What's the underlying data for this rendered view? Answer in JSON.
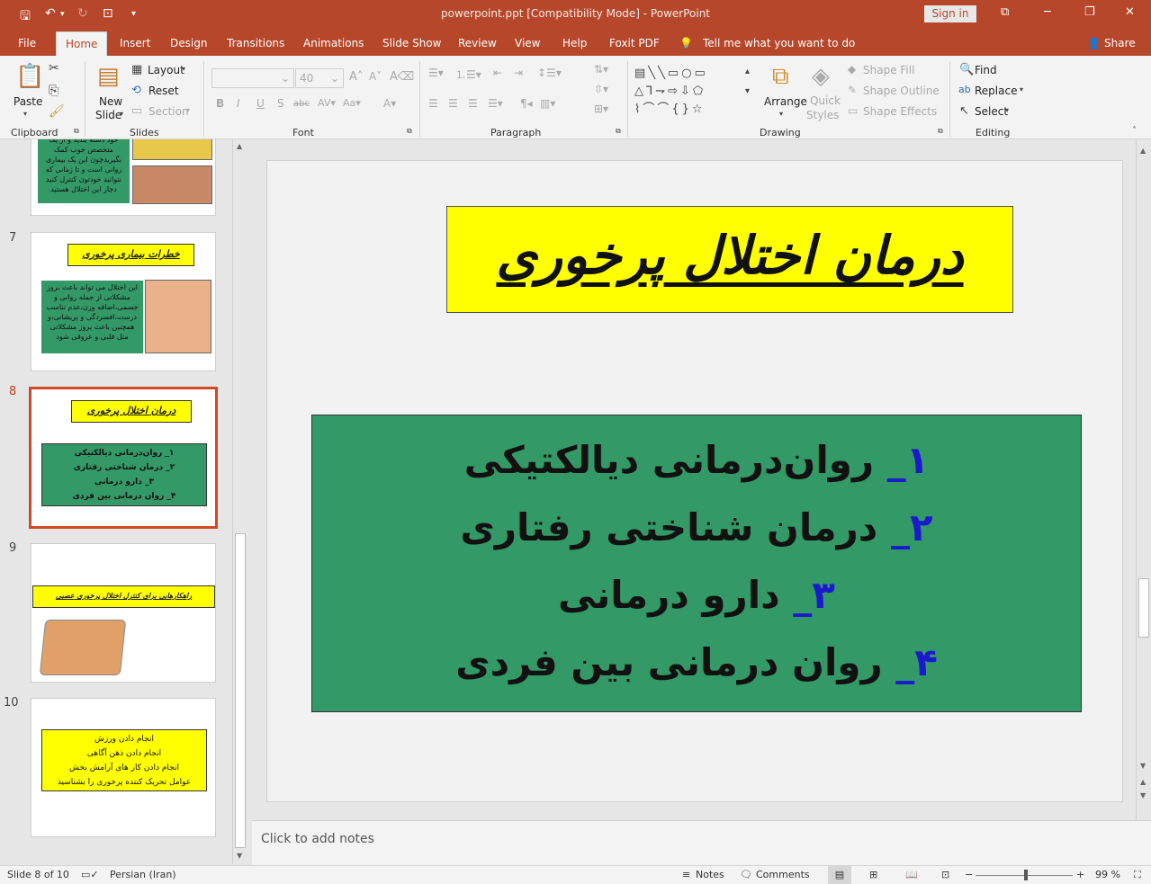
{
  "window": {
    "title": "powerpoint.ppt [Compatibility Mode]  -  PowerPoint",
    "sign_in": "Sign in"
  },
  "menu": {
    "file": "File",
    "home": "Home",
    "insert": "Insert",
    "design": "Design",
    "transitions": "Transitions",
    "animations": "Animations",
    "slide_show": "Slide Show",
    "review": "Review",
    "view": "View",
    "help": "Help",
    "foxit": "Foxit PDF",
    "tell_me": "Tell me what you want to do",
    "share": "Share"
  },
  "ribbon": {
    "paste": "Paste",
    "new_slide": "New\nSlide",
    "new_label_1": "New",
    "new_label_2": "Slide",
    "layout": "Layout",
    "reset": "Reset",
    "section": "Section",
    "font_size": "40",
    "arrange": "Arrange",
    "quick": "Quick",
    "styles": "Styles",
    "shape_fill": "Shape Fill",
    "shape_outline": "Shape Outline",
    "shape_effects": "Shape Effects",
    "find": "Find",
    "replace": "Replace",
    "select": "Select",
    "groups": {
      "clipboard": "Clipboard",
      "slides": "Slides",
      "font": "Font",
      "paragraph": "Paragraph",
      "drawing": "Drawing",
      "editing": "Editing"
    }
  },
  "thumbnails": {
    "partial_text": "خود دسته بندید و از یک متخصص خوب کمک بگیریدچون این یک بیماری روانی است و تا زمانی که نتوانید خودتون کنترل کنید دچار این اختلال هستید",
    "slide7": {
      "num": "7",
      "title": "خطرات بیماری پرخوری",
      "text": "این اختلال می تواند باعث بروز مشکلاتی از جمله روانی و جسمی،اضافه وزن،عدم تناسب درست،افسردگی و پریشانی،و همچنین باعث بروز مشکلاتی مثل قلبی و عروقی شود"
    },
    "slide8": {
      "num": "8",
      "title": "درمان اختلال پرخوری",
      "items": [
        "۱_ روان‌درمانی دیالکتیکی",
        "۲_ درمان شناختی رفتاری",
        "۳_ دارو درمانی",
        "۴_ روان درمانی بین فردی"
      ]
    },
    "slide9": {
      "num": "9",
      "title": "راهکارهایی برای کنترل اختلال پرخوری عصبی"
    },
    "slide10": {
      "num": "10",
      "items": [
        "انجام دادن ورزش",
        "انجام دادن ذهن آگاهی",
        "انجام دادن کار های آرامش بخش",
        "عوامل تحریک کننده پرخوری را بشناسید"
      ]
    }
  },
  "slide": {
    "title": "درمان اختلال پرخوری",
    "items": [
      {
        "num": "۱_",
        "text": " روان‌درمانی دیالکتیکی"
      },
      {
        "num": "۲_",
        "text": " درمان شناختی رفتاری"
      },
      {
        "num": "۳_",
        "text": " دارو درمانی"
      },
      {
        "num": "۴_",
        "text": " روان درمانی بین فردی"
      }
    ],
    "title_bg": "#ffff00",
    "body_bg": "#339966",
    "num_color": "#1a1acc"
  },
  "notes_placeholder": "Click to add notes",
  "status": {
    "slide": "Slide 8 of 10",
    "language": "Persian (Iran)",
    "notes": "Notes",
    "comments": "Comments",
    "zoom": "99 %"
  },
  "colors": {
    "accent": "#b7472a",
    "selected_thumb": "#d04a25"
  }
}
